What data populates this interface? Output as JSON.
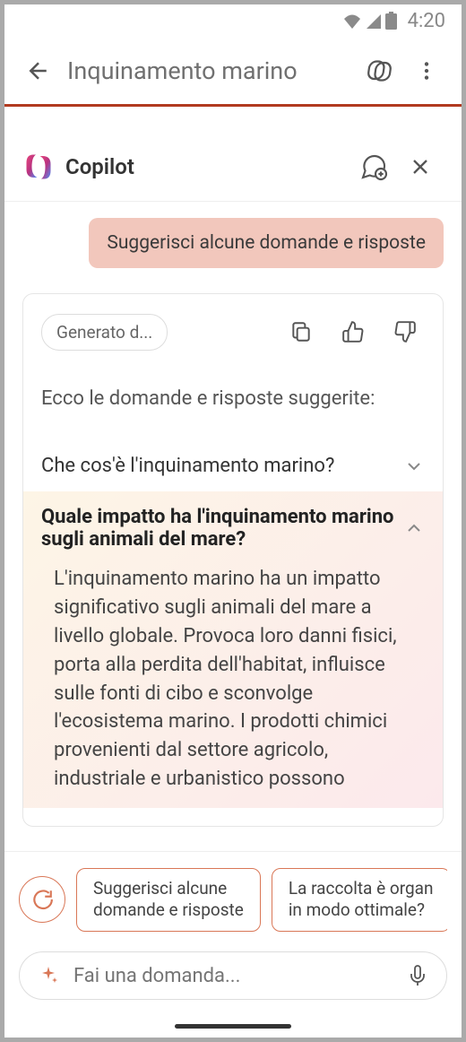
{
  "statusBar": {
    "time": "4:20"
  },
  "header": {
    "title": "Inquinamento marino"
  },
  "copilot": {
    "title": "Copilot"
  },
  "userMessage": "Suggerisci alcune domande e risposte",
  "response": {
    "generatedBadge": "Generato d...",
    "intro": "Ecco le domande e risposte suggerite:",
    "qa": [
      {
        "question": "Che cos'è l'inquinamento marino?",
        "expanded": false
      },
      {
        "question": "Quale impatto ha l'inquinamento marino sugli animali del mare?",
        "answer": "L'inquinamento marino ha un impatto significativo sugli animali del mare a livello globale. Provoca loro danni fisici, porta alla perdita dell'habitat, influisce sulle fonti di cibo e sconvolge l'ecosistema marino. I prodotti chimici provenienti dal settore agricolo, industriale e urbanistico possono",
        "expanded": true
      }
    ]
  },
  "suggestions": [
    "Suggerisci alcune\ndomande e risposte",
    "La raccolta è organ\nin modo ottimale?"
  ],
  "input": {
    "placeholder": "Fai una domanda..."
  }
}
